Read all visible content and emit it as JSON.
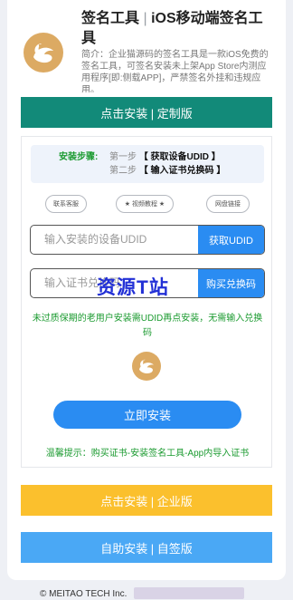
{
  "header": {
    "title_main": "签名工具",
    "title_sep": "|",
    "title_sub": "iOS移动端签名工具",
    "description": "简介：企业猫源码的签名工具是一款iOS免费的签名工具，可签名安装未上架App Store内测应用程序[即:侧载APP]，严禁签名外挂和违规应用。"
  },
  "buttons": {
    "custom": "点击安装 | 定制版",
    "enterprise": "点击安装 | 企业版",
    "self_sign": "自助安装 | 自签版",
    "install": "立即安装"
  },
  "steps": {
    "label": "安装步骤:",
    "step1_key": "第一步",
    "step1_value": "【 获取设备UDID 】",
    "step2_key": "第二步",
    "step2_value": "【 输入证书兑换码 】"
  },
  "chips": {
    "service": "联系客服",
    "tutorial": "★ 视频教程 ★",
    "disk": "网盘链接"
  },
  "udid": {
    "placeholder": "输入安装的设备UDID",
    "action": "获取UDID"
  },
  "code": {
    "placeholder": "输入证书兑换码",
    "action": "购买兑换码"
  },
  "watermark": "资源T站",
  "note": "未过质保期的老用户安装需UDID再点安装，无需输入兑换码",
  "tip": "温馨提示：购买证书-安装签名工具-App内导入证书",
  "footer": "© MEITAO TECH Inc.",
  "colors": {
    "green": "#128a79",
    "blue": "#2a8cf2",
    "yellow": "#fbc02d",
    "light_blue": "#4aa8f5",
    "gold": "#dcaa63",
    "note_green": "#1a9a2f"
  },
  "icons": {
    "logo": "swan-logo-icon"
  }
}
